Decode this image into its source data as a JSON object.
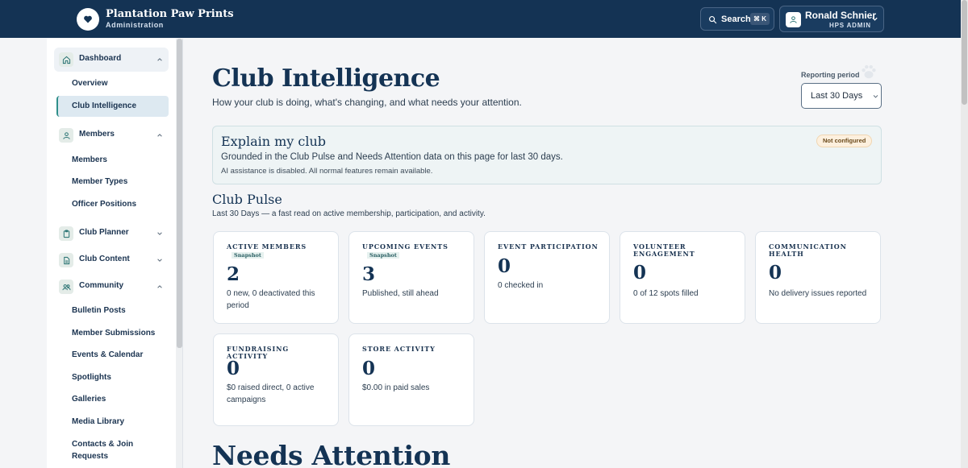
{
  "header": {
    "brand_title": "Plantation Paw Prints",
    "brand_subtitle": "Administration",
    "search_label": "Search",
    "search_shortcut": "⌘ K",
    "user_name": "Ronald Schnier",
    "user_role": "HPS ADMIN",
    "icons": [
      "heart-icon",
      "search-icon",
      "user-icon",
      "chevron-down-icon"
    ]
  },
  "sidebar": {
    "sections": [
      {
        "label": "Dashboard",
        "icon": "home-icon",
        "items": [
          "Overview",
          "Club Intelligence"
        ],
        "active_item": "Club Intelligence"
      },
      {
        "label": "Members",
        "icon": "user-icon",
        "items": [
          "Members",
          "Member Types",
          "Officer Positions"
        ]
      },
      {
        "label": "Club Planner",
        "icon": "clipboard-icon",
        "items": []
      },
      {
        "label": "Club Content",
        "icon": "document-icon",
        "items": []
      },
      {
        "label": "Community",
        "icon": "users-icon",
        "items": [
          "Bulletin Posts",
          "Member Submissions",
          "Events & Calendar",
          "Spotlights",
          "Galleries",
          "Media Library",
          "Contacts & Join Requests"
        ]
      }
    ]
  },
  "main": {
    "title": "Club Intelligence",
    "subtitle": "How your club is doing, what's changing, and what needs your attention.",
    "reporting_period_label": "Reporting period",
    "reporting_period_value": "Last 30 Days",
    "explain": {
      "title": "Explain my club",
      "description": "Grounded in the Club Pulse and Needs Attention data on this page for last 30 days.",
      "note": "AI assistance is disabled. All normal features remain available.",
      "badge": "Not configured"
    },
    "pulse": {
      "title": "Club Pulse",
      "subtitle": "Last 30 Days — a fast read on active membership, participation, and activity."
    },
    "cards": [
      {
        "label": "Active Members",
        "tag": "Snapshot",
        "value": "2",
        "desc": "0 new, 0 deactivated this period"
      },
      {
        "label": "Upcoming Events",
        "tag": "Snapshot",
        "value": "3",
        "desc": "Published, still ahead"
      },
      {
        "label": "Event Participation",
        "tag": "",
        "value": "0",
        "desc": "0 checked in"
      },
      {
        "label": "Volunteer Engagement",
        "tag": "",
        "value": "0",
        "desc": "0 of 12 spots filled"
      },
      {
        "label": "Communication Health",
        "tag": "",
        "value": "0",
        "desc": "No delivery issues reported"
      },
      {
        "label": "Fundraising Activity",
        "tag": "",
        "value": "0",
        "desc": "$0 raised direct, 0 active campaigns"
      },
      {
        "label": "Store Activity",
        "tag": "",
        "value": "0",
        "desc": "$0.00 in paid sales"
      }
    ],
    "needs_title": "Needs Attention"
  }
}
